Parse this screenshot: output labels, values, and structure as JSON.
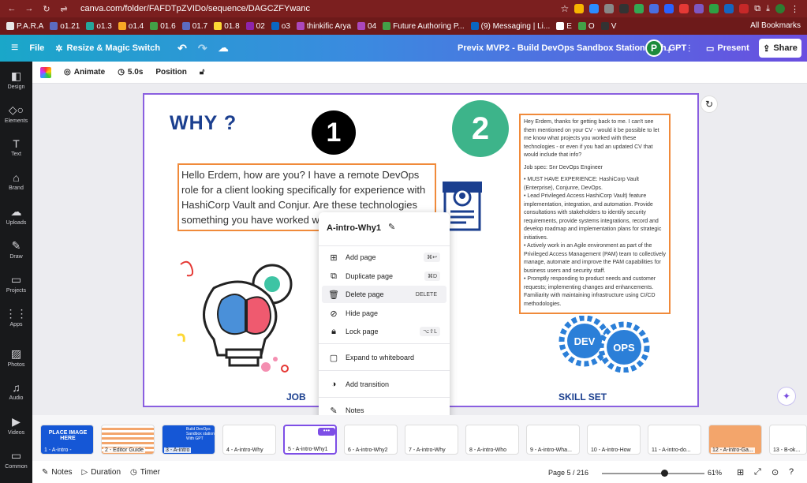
{
  "browser": {
    "url": "canva.com/folder/FAFDTpZVIDo/sequence/DAGCZFYwanc",
    "bookmarks": [
      "P.A.R.A",
      "o1.21",
      "o1.3",
      "o1.4",
      "01.6",
      "01.7",
      "01.8",
      "02",
      "o3",
      "thinkific Arya",
      "04",
      "Future Authoring P...",
      "(9) Messaging | Li...",
      "E",
      "O",
      "V"
    ],
    "all_bookmarks": "All Bookmarks"
  },
  "header": {
    "file": "File",
    "resize": "Resize & Magic Switch",
    "title": "Previx MVP2 - Build DevOps Sandbox Station  With GPT",
    "avatar": "P",
    "present": "Present",
    "share": "Share"
  },
  "sidebar": {
    "items": [
      "Design",
      "Elements",
      "Text",
      "Brand",
      "Uploads",
      "Draw",
      "Projects",
      "Apps",
      "Photos",
      "Audio",
      "Videos",
      "Common"
    ]
  },
  "toolbar": {
    "animate": "Animate",
    "duration": "5.0s",
    "position": "Position"
  },
  "slide": {
    "title": "WHY ?",
    "num1": "1",
    "num2": "2",
    "message": "Hello Erdem, how are you? I have a remote DevOps role for a client looking specifically for experience with HashiCorp Vault and Conjur. Are these technologies something you have worked with?",
    "job_text": [
      "Hey Erdem, thanks for getting back to me. I can't see them mentioned on your CV - would it be possible to let me know what projects you worked with these technologies - or even if you had an updated CV that would include that info?",
      "Job spec: Snr DevOps Engineer",
      "• MUST HAVE EXPERIENCE: HashiCorp Vault (Enterprise), Conjunre, DevOps.\n• Lead Privileged Access HashiCorp Vault) feature implementation, integration, and automation. Provide consultations with stakeholders to identify security requirements, provide systems integrations, record and develop roadmap and implementation plans for strategic initiatives.\n• Actively work in an Agile environment as part of the Privileged Access Management (PAM) team to collectively manage, automate and improve the PAM capabilities for business users and security staff.\n• Promptly responding to product needs and customer requests; implementing changes and enhancements. Familiarity with maintaining infrastructure using CI/CD methodologies."
    ],
    "dev": "DEV",
    "ops": "OPS",
    "job_label": "JOB",
    "skill_label": "SKILL SET"
  },
  "context_menu": {
    "title": "A-intro-Why1",
    "items": [
      {
        "label": "Add page",
        "shortcut": "⌘↩"
      },
      {
        "label": "Duplicate page",
        "shortcut": "⌘D"
      },
      {
        "label": "Delete page",
        "shortcut": "DELETE"
      },
      {
        "label": "Hide page",
        "shortcut": ""
      },
      {
        "label": "Lock page",
        "shortcut": "⌥⇧L"
      },
      {
        "label": "Expand to whiteboard",
        "shortcut": ""
      },
      {
        "label": "Add transition",
        "shortcut": ""
      },
      {
        "label": "Notes",
        "shortcut": ""
      }
    ]
  },
  "filmstrip": {
    "pages": [
      {
        "label": "1 - A-intro -",
        "text": "PLACE IMAGE HERE"
      },
      {
        "label": "2 - Editor Guide",
        "text": ""
      },
      {
        "label": "3 - A-intro",
        "text": "Build DevOps Sandbox station With GPT"
      },
      {
        "label": "4 - A-intro-Why",
        "text": ""
      },
      {
        "label": "5 - A-intro-Why1",
        "text": ""
      },
      {
        "label": "6 - A-intro-Why2",
        "text": ""
      },
      {
        "label": "7 - A-intro-Why",
        "text": ""
      },
      {
        "label": "8 - A-intro-Who",
        "text": ""
      },
      {
        "label": "9 - A-intro-Wha...",
        "text": ""
      },
      {
        "label": "10 - A-intro-How",
        "text": ""
      },
      {
        "label": "11 - A-intro-do...",
        "text": ""
      },
      {
        "label": "12 - A-intro-Ga...",
        "text": ""
      },
      {
        "label": "13 - B-ok...",
        "text": ""
      }
    ]
  },
  "bottom": {
    "notes": "Notes",
    "duration": "Duration",
    "timer": "Timer",
    "page": "Page 5 / 216",
    "zoom": "61%",
    "zoom_fraction": 0.61
  },
  "colors": {
    "accent": "#7d4ee6",
    "orange": "#f08a3a",
    "navy": "#1b3f8f",
    "green": "#3db48a"
  }
}
